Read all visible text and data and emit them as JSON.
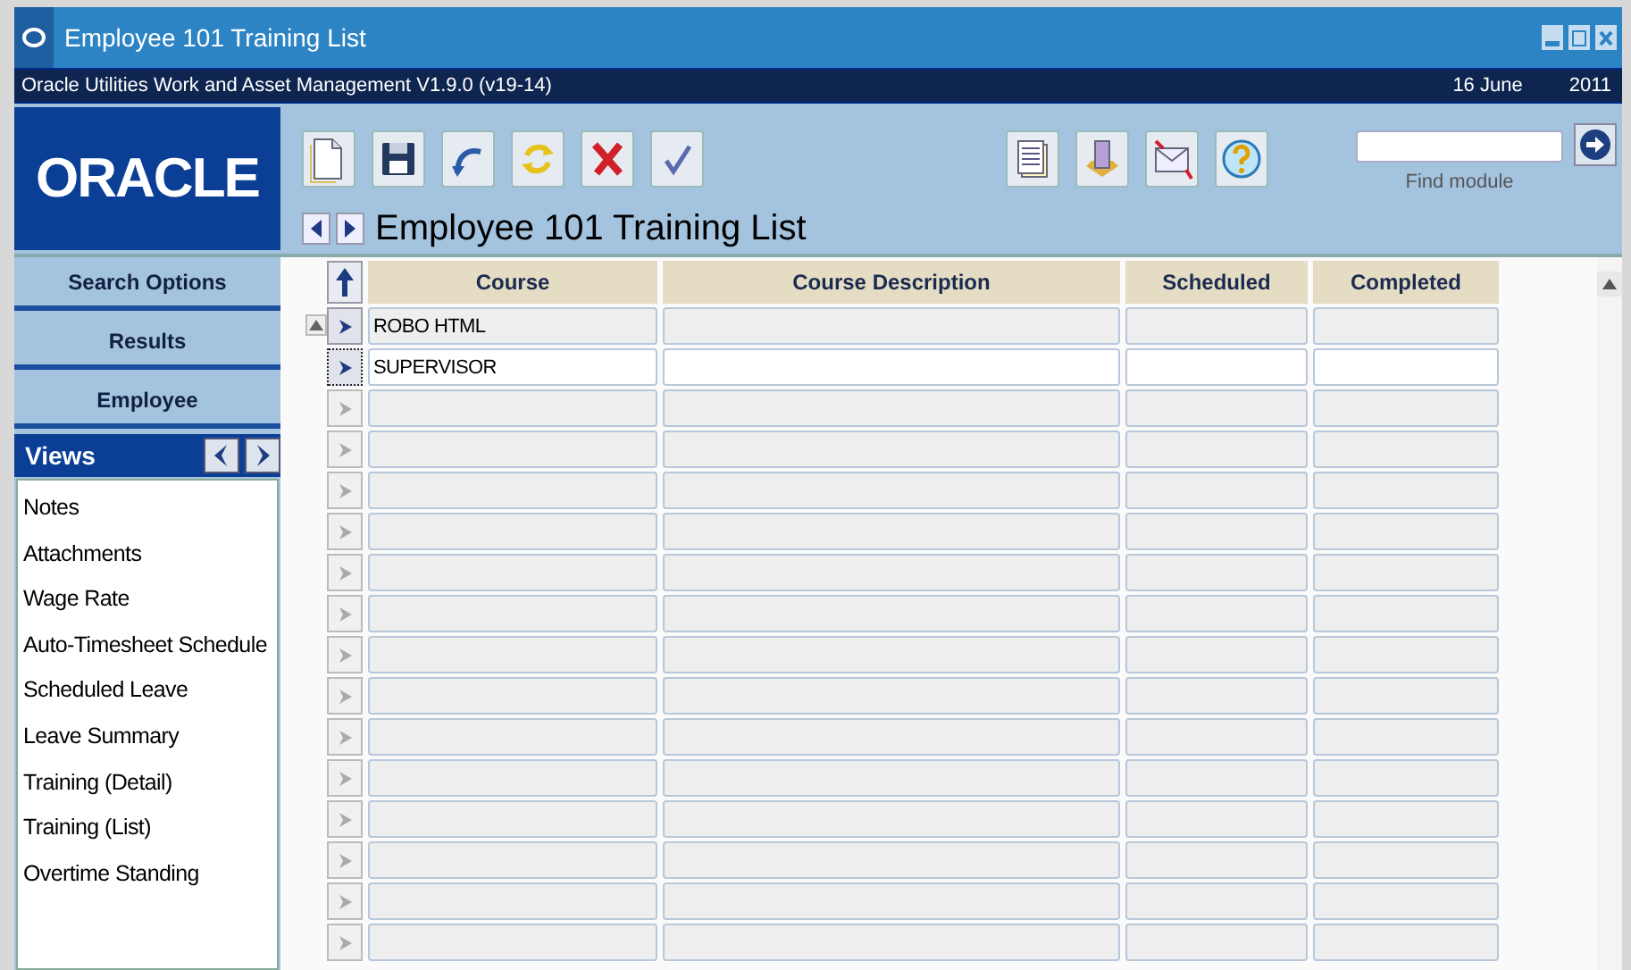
{
  "window": {
    "title": "Employee 101 Training List"
  },
  "app_bar": {
    "product": "Oracle Utilities Work and Asset Management V1.9.0 (v19-14)",
    "date": "16 June",
    "year": "2011"
  },
  "logo": {
    "text": "ORACLE"
  },
  "find_module": {
    "label": "Find module"
  },
  "page_title": "Employee 101 Training List",
  "sidebar": {
    "buttons": [
      "Search Options",
      "Results",
      "Employee"
    ],
    "views_title": "Views",
    "views": [
      "Notes",
      "Attachments",
      "Wage Rate",
      "Auto-Timesheet Schedule",
      "Scheduled Leave",
      "Leave Summary",
      "Training (Detail)",
      "Training (List)",
      "Overtime Standing"
    ]
  },
  "table": {
    "columns": [
      "Course",
      "Course Description",
      "Scheduled",
      "Completed"
    ],
    "rows": [
      {
        "course": "ROBO HTML",
        "selected": false
      },
      {
        "course": "SUPERVISOR",
        "selected": true
      }
    ]
  }
}
